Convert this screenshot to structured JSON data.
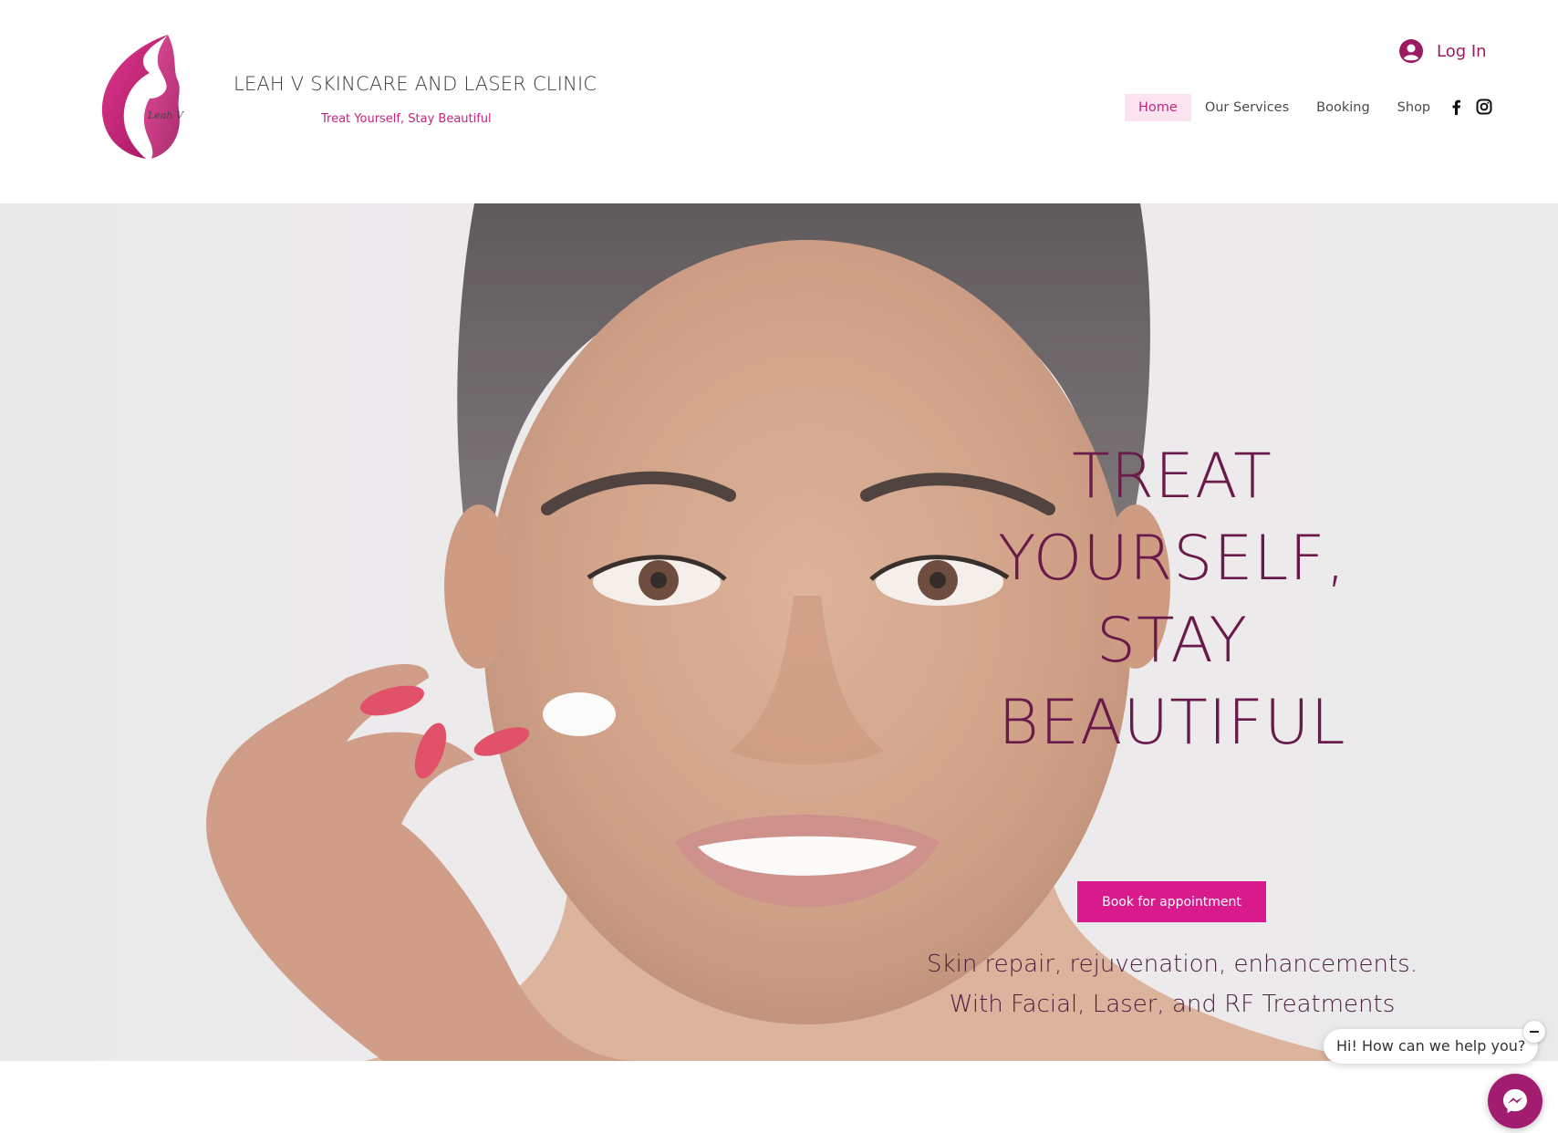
{
  "site": {
    "title": "LEAH V SKINCARE AND LASER CLINIC",
    "tagline": "Treat Yourself, Stay Beautiful",
    "logo_signature": "Leah V"
  },
  "header": {
    "login_label": "Log In",
    "nav": [
      {
        "label": "Home",
        "active": true
      },
      {
        "label": "Our Services",
        "active": false
      },
      {
        "label": "Booking",
        "active": false
      },
      {
        "label": "Shop",
        "active": false
      }
    ],
    "social_icons": [
      "facebook-icon",
      "instagram-icon"
    ]
  },
  "hero": {
    "headline_lines": [
      "TREAT",
      "YOURSELF,",
      "STAY",
      "BEAUTIFUL"
    ],
    "cta_label": "Book for appointment",
    "sub_lines": [
      "Skin repair, rejuvenation, enhancements.",
      "With Facial, Laser, and RF Treatments"
    ]
  },
  "chat": {
    "greeting": "Hi! How can we help you?"
  },
  "colors": {
    "brand_pink": "#d91a8c",
    "headline_plum": "#6a1a4a",
    "nav_active_bg": "#fbe4ef",
    "chat_purple": "#a21d70"
  }
}
